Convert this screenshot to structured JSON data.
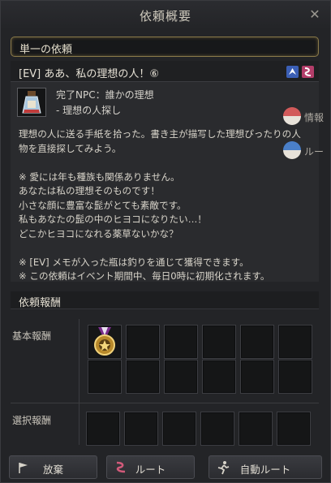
{
  "window": {
    "title": "依頼概要",
    "close_label": "✕"
  },
  "category": "単一の依頼",
  "quest": {
    "title": "[EV] ああ、私の理想の人！⑥",
    "npc_line": "完了NPC：誰かの理想",
    "target_line": "- 理想の人探し",
    "description": "理想の人に送る手紙を拾った。書き主が描写した理想ぴったりの人\n物を直接探してみよう。\n\n※ 愛には年も種族も関係ありません。\nあなたは私の理想そのものです！\n小さな顔に豊富な髭がとても素敵です。\n私もあなたの髭の中のヒヨコになりたい…！\nどこかヒヨコになれる薬草ないかな？\n\n※ [EV] メモが入った瓶は釣りを通じて獲得できます。\n※ この依頼はイベント期間中、毎日0時に初期化されます。"
  },
  "side_buttons": {
    "info": "情報",
    "route": "ルー"
  },
  "rewards": {
    "header": "依頼報酬",
    "basic_label": "基本報酬",
    "select_label": "選択報酬"
  },
  "buttons": {
    "abandon": "放棄",
    "route": "ルート",
    "auto_route": "自動ルート"
  }
}
